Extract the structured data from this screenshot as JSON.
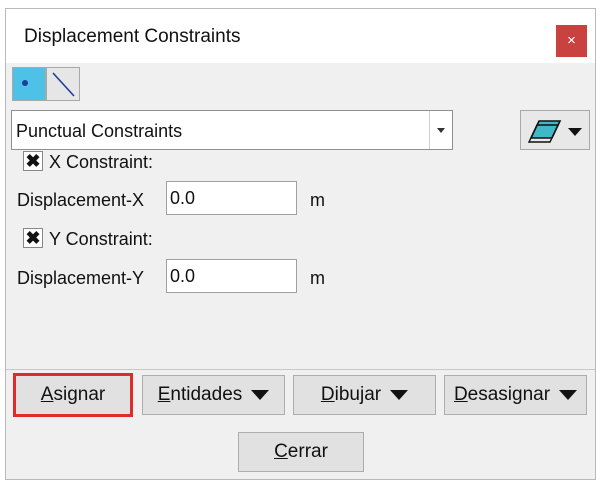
{
  "window": {
    "title": "Displacement Constraints",
    "close_glyph": "×"
  },
  "toolbar": {
    "point_tool": "point-icon",
    "line_tool": "line-icon"
  },
  "constraint_type": {
    "selected": "Punctual Constraints"
  },
  "layer_menu": {
    "icon": "layer-icon"
  },
  "x_constraint": {
    "checked": true,
    "check_glyph": "✖",
    "label": "X Constraint:",
    "field_label": "Displacement-X",
    "value": "0.0",
    "unit": "m"
  },
  "y_constraint": {
    "checked": true,
    "check_glyph": "✖",
    "label": "Y Constraint:",
    "field_label": "Displacement-Y",
    "value": "0.0",
    "unit": "m"
  },
  "actions": {
    "assign": {
      "first": "A",
      "rest": "signar"
    },
    "entities": {
      "first": "E",
      "rest": "ntidades"
    },
    "draw": {
      "first": "D",
      "rest": "ibujar"
    },
    "unassign": {
      "first": "D",
      "rest": "esasignar"
    },
    "close": {
      "first": "C",
      "rest": "errar"
    }
  },
  "colors": {
    "close_button": "#c9423f",
    "point_tool_active": "#4ec1e7",
    "highlight_outline": "#e02b2b"
  }
}
